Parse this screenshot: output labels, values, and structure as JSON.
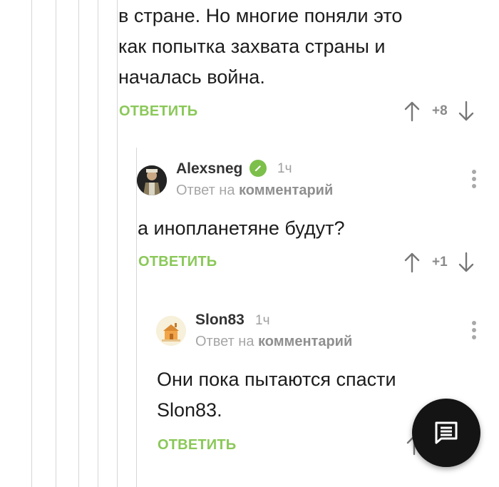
{
  "comments": [
    {
      "text_lines": [
        "в стране. Но многие поняли это",
        "как попытка захвата страны и",
        "началась война."
      ],
      "reply_label": "ОТВЕТИТЬ",
      "score": "+8"
    },
    {
      "author": "Alexsneg",
      "time": "1ч",
      "reply_prefix": "Ответ на",
      "reply_link": "комментарий",
      "text_lines": [
        "а инопланетяне будут?"
      ],
      "reply_label": "ОТВЕТИТЬ",
      "score": "+1",
      "avatar_icon": "user-avatar-icon",
      "verified_icon": "verified-check-icon"
    },
    {
      "author": "Slon83",
      "time": "1ч",
      "reply_prefix": "Ответ на",
      "reply_link": "комментарий",
      "text_lines": [
        "Они пока пытаются спасти",
        "Slon83."
      ],
      "reply_label": "ОТВЕТИТЬ",
      "avatar_icon": "house-avatar-icon"
    }
  ],
  "fab": {
    "icon": "comment-icon"
  },
  "colors": {
    "accent": "#8ac858",
    "verified": "#7cbf4a",
    "fab": "#141414"
  }
}
